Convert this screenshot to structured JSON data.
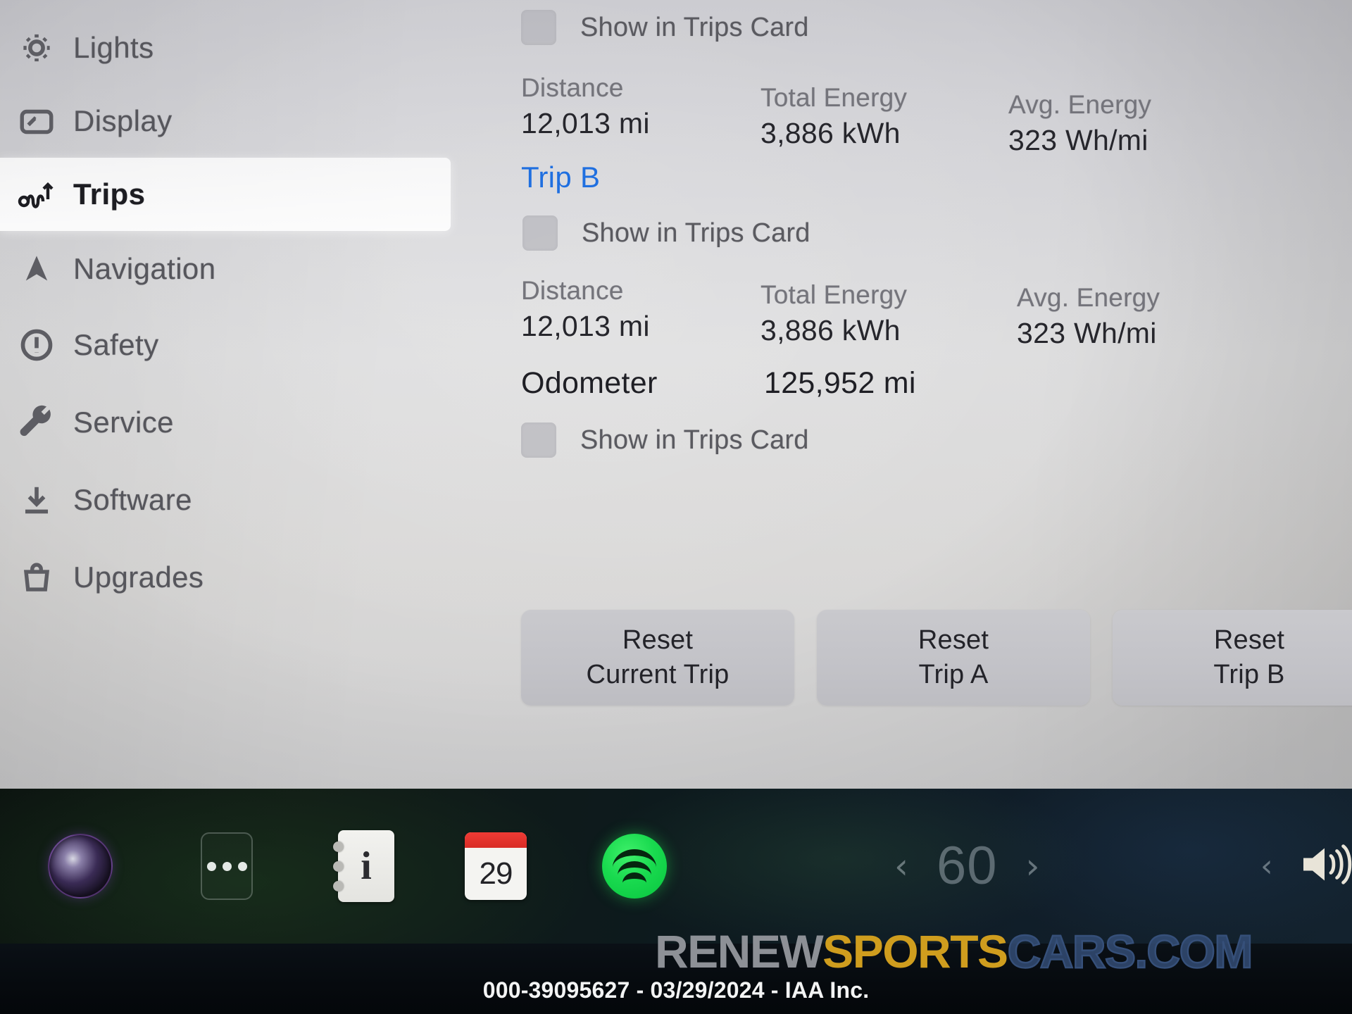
{
  "sidebar": {
    "items": [
      {
        "label": "Lights",
        "icon": "lightbulb-icon",
        "active": false
      },
      {
        "label": "Display",
        "icon": "display-icon",
        "active": false
      },
      {
        "label": "Trips",
        "icon": "trips-route-icon",
        "active": true
      },
      {
        "label": "Navigation",
        "icon": "navigation-icon",
        "active": false
      },
      {
        "label": "Safety",
        "icon": "warning-icon",
        "active": false
      },
      {
        "label": "Service",
        "icon": "wrench-icon",
        "active": false
      },
      {
        "label": "Software",
        "icon": "download-icon",
        "active": false
      },
      {
        "label": "Upgrades",
        "icon": "shopping-bag-icon",
        "active": false
      }
    ]
  },
  "trips": {
    "checkbox_label": "Show in Trips Card",
    "trip_a": {
      "show_in_trips_card": "Show in Trips Card",
      "stats": [
        {
          "label": "Distance",
          "value": "12,013 mi"
        },
        {
          "label": "Total Energy",
          "value": "3,886 kWh"
        },
        {
          "label": "Avg. Energy",
          "value": "323 Wh/mi"
        }
      ]
    },
    "trip_b": {
      "heading": "Trip B",
      "heading_color": "#1f6fe0",
      "show_in_trips_card": "Show in Trips Card",
      "stats": [
        {
          "label": "Distance",
          "value": "12,013 mi"
        },
        {
          "label": "Total Energy",
          "value": "3,886 kWh"
        },
        {
          "label": "Avg. Energy",
          "value": "323 Wh/mi"
        }
      ]
    },
    "odometer": {
      "label": "Odometer",
      "value": "125,952 mi",
      "show_in_trips_card": "Show in Trips Card"
    },
    "reset_buttons": [
      {
        "line1": "Reset",
        "line2": "Current Trip"
      },
      {
        "line1": "Reset",
        "line2": "Trip A"
      },
      {
        "line1": "Reset",
        "line2": "Trip B"
      }
    ]
  },
  "taskbar": {
    "apps": [
      {
        "name": "nav-app-icon",
        "label": ""
      },
      {
        "name": "more-apps-icon",
        "label": ""
      },
      {
        "name": "info-notes-icon",
        "label": "i"
      },
      {
        "name": "calendar-icon",
        "label": "29"
      },
      {
        "name": "spotify-icon",
        "label": ""
      }
    ],
    "climate": {
      "temperature": "60",
      "decrease_icon": "chevron-left-icon",
      "increase_icon": "chevron-right-icon"
    },
    "right_chevron": "‹",
    "volume_icon": "volume-speaker-icon"
  },
  "footer": {
    "watermark": {
      "part1": "RENEW",
      "part2": "SPORTS",
      "part3": "CARS.COM",
      "color1": "#8d9096",
      "color2": "#cf9d1e",
      "color3": "#36507a"
    },
    "stock_line": "000-39095627 - 03/29/2024 - IAA Inc."
  }
}
